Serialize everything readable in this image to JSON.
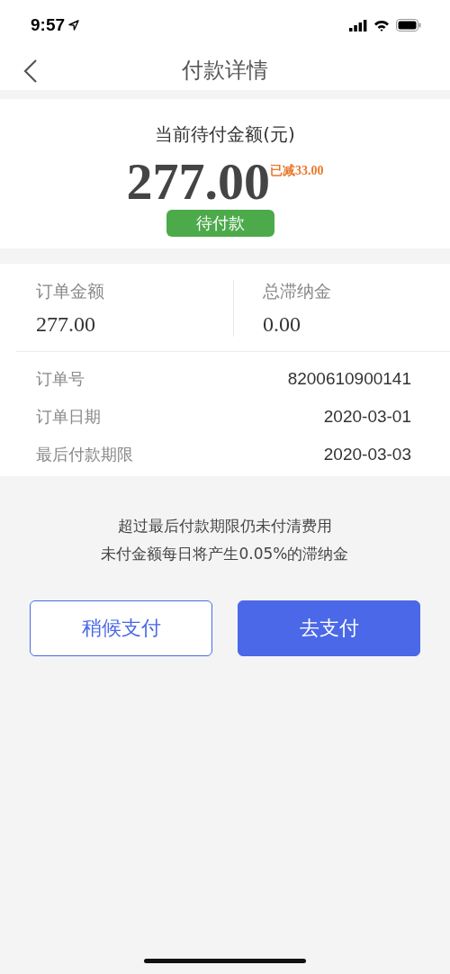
{
  "status_bar": {
    "time": "9:57"
  },
  "nav": {
    "title": "付款详情"
  },
  "amount_card": {
    "label": "当前待付金额(元)",
    "amount": "277.00",
    "discount": "已减33.00",
    "status": "待付款"
  },
  "summary": [
    {
      "label": "订单金额",
      "value": "277.00"
    },
    {
      "label": "总滞纳金",
      "value": "0.00"
    }
  ],
  "details": [
    {
      "label": "订单号",
      "value": "8200610900141"
    },
    {
      "label": "订单日期",
      "value": "2020-03-01"
    },
    {
      "label": "最后付款期限",
      "value": "2020-03-03"
    }
  ],
  "notice": [
    "超过最后付款期限仍未付清费用",
    "未付金额每日将产生0.05%的滞纳金"
  ],
  "buttons": [
    {
      "label": "稍候支付",
      "kind": "outline"
    },
    {
      "label": "去支付",
      "kind": "primary"
    }
  ]
}
